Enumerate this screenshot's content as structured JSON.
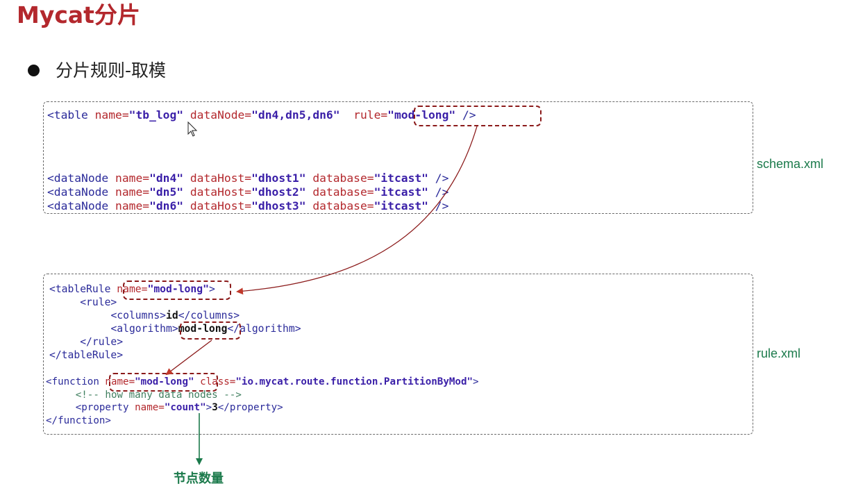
{
  "page": {
    "title": "Mycat分片",
    "bullet": "分片规则-取模"
  },
  "schema": {
    "label": "schema.xml",
    "table": {
      "open": "<table",
      "name_attr": " name=",
      "name_val": "\"tb_log\"",
      "datanode_attr": " dataNode=",
      "datanode_val": "\"dn4,dn5,dn6\"",
      "rule_attr": "rule=",
      "rule_val": "\"mod-long\"",
      "close": " />"
    },
    "datanodes": [
      {
        "open": "<dataNode",
        "name_attr": " name=",
        "name_val": "\"dn4\"",
        "host_attr": " dataHost=",
        "host_val": "\"dhost1\"",
        "db_attr": " database=",
        "db_val": "\"itcast\"",
        "close": " />"
      },
      {
        "open": "<dataNode",
        "name_attr": " name=",
        "name_val": "\"dn5\"",
        "host_attr": " dataHost=",
        "host_val": "\"dhost2\"",
        "db_attr": " database=",
        "db_val": "\"itcast\"",
        "close": " />"
      },
      {
        "open": "<dataNode",
        "name_attr": " name=",
        "name_val": "\"dn6\"",
        "host_attr": " dataHost=",
        "host_val": "\"dhost3\"",
        "db_attr": " database=",
        "db_val": "\"itcast\"",
        "close": " />"
      }
    ]
  },
  "rule": {
    "label": "rule.xml",
    "tablerule": {
      "open": "<tableRule",
      "name_attr": "name=",
      "name_val": "\"mod-long\"",
      "open_end": ">",
      "rule_open": "<rule>",
      "columns_open": "<columns>",
      "columns_val": "id",
      "columns_close": "</columns>",
      "algorithm_open": "<algorithm>",
      "algorithm_val": "mod-long",
      "algorithm_close": "</algorithm>",
      "rule_close": "</rule>",
      "close": "</tableRule>"
    },
    "function": {
      "open": "<function",
      "name_attr": "name=",
      "name_val": "\"mod-long\"",
      "class_attr": " class=",
      "class_val": "\"io.mycat.route.function.PartitionByMod\"",
      "open_end": ">",
      "comment": "<!-- how many data nodes -->",
      "property_open": "<property",
      "property_name_attr": " name=",
      "property_name_val": "\"count\"",
      "property_gt": ">",
      "property_val": "3",
      "property_close": "</property>",
      "close": "</function>"
    },
    "bottom_label": "节点数量"
  },
  "colors": {
    "title": "#b3282d",
    "tag": "#2b2b9a",
    "attr": "#b3282d",
    "value": "#3a1fa8",
    "highlight_border": "#8b1a1a",
    "label_green": "#1b7a4b",
    "arrow_red": "#c0392b"
  }
}
